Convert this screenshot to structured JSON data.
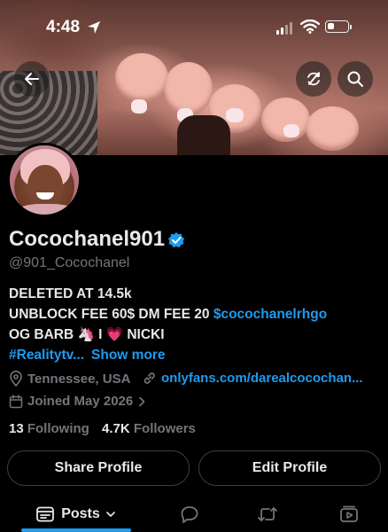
{
  "status_bar": {
    "time": "4:48",
    "battery_level": 0.35
  },
  "profile": {
    "display_name": "Cocochanel901",
    "handle": "@901_Cocochanel",
    "bio_line1": "DELETED AT 14.5k",
    "bio_line2_text": "UNBLOCK FEE 60$ DM FEE 20 ",
    "bio_line2_link": "$cocochanelrhgo",
    "bio_line3": "OG BARB 🦄 I 💗 NICKI",
    "bio_hashtag": "#Realitytv...",
    "show_more": "Show more",
    "location": "Tennessee, USA",
    "website": "onlyfans.com/darealcocochan...",
    "joined": "Joined May 2026",
    "following_count": "13",
    "following_label": "Following",
    "followers_count": "4.7K",
    "followers_label": "Followers"
  },
  "buttons": {
    "share_profile": "Share Profile",
    "edit_profile": "Edit Profile"
  },
  "tabs": {
    "posts_label": "Posts"
  },
  "icons": {
    "back": "arrow-left-icon",
    "refresh": "refresh-off-icon",
    "search": "search-icon",
    "verified": "verified-badge-icon",
    "location": "location-pin-icon",
    "link": "link-icon",
    "calendar": "calendar-icon",
    "replies": "speech-bubble-icon",
    "media": "repost-icon",
    "videos": "video-play-icon"
  },
  "colors": {
    "accent": "#1d9bf0",
    "background": "#000000",
    "text_primary": "#e7e9ea",
    "text_secondary": "#71767b"
  }
}
